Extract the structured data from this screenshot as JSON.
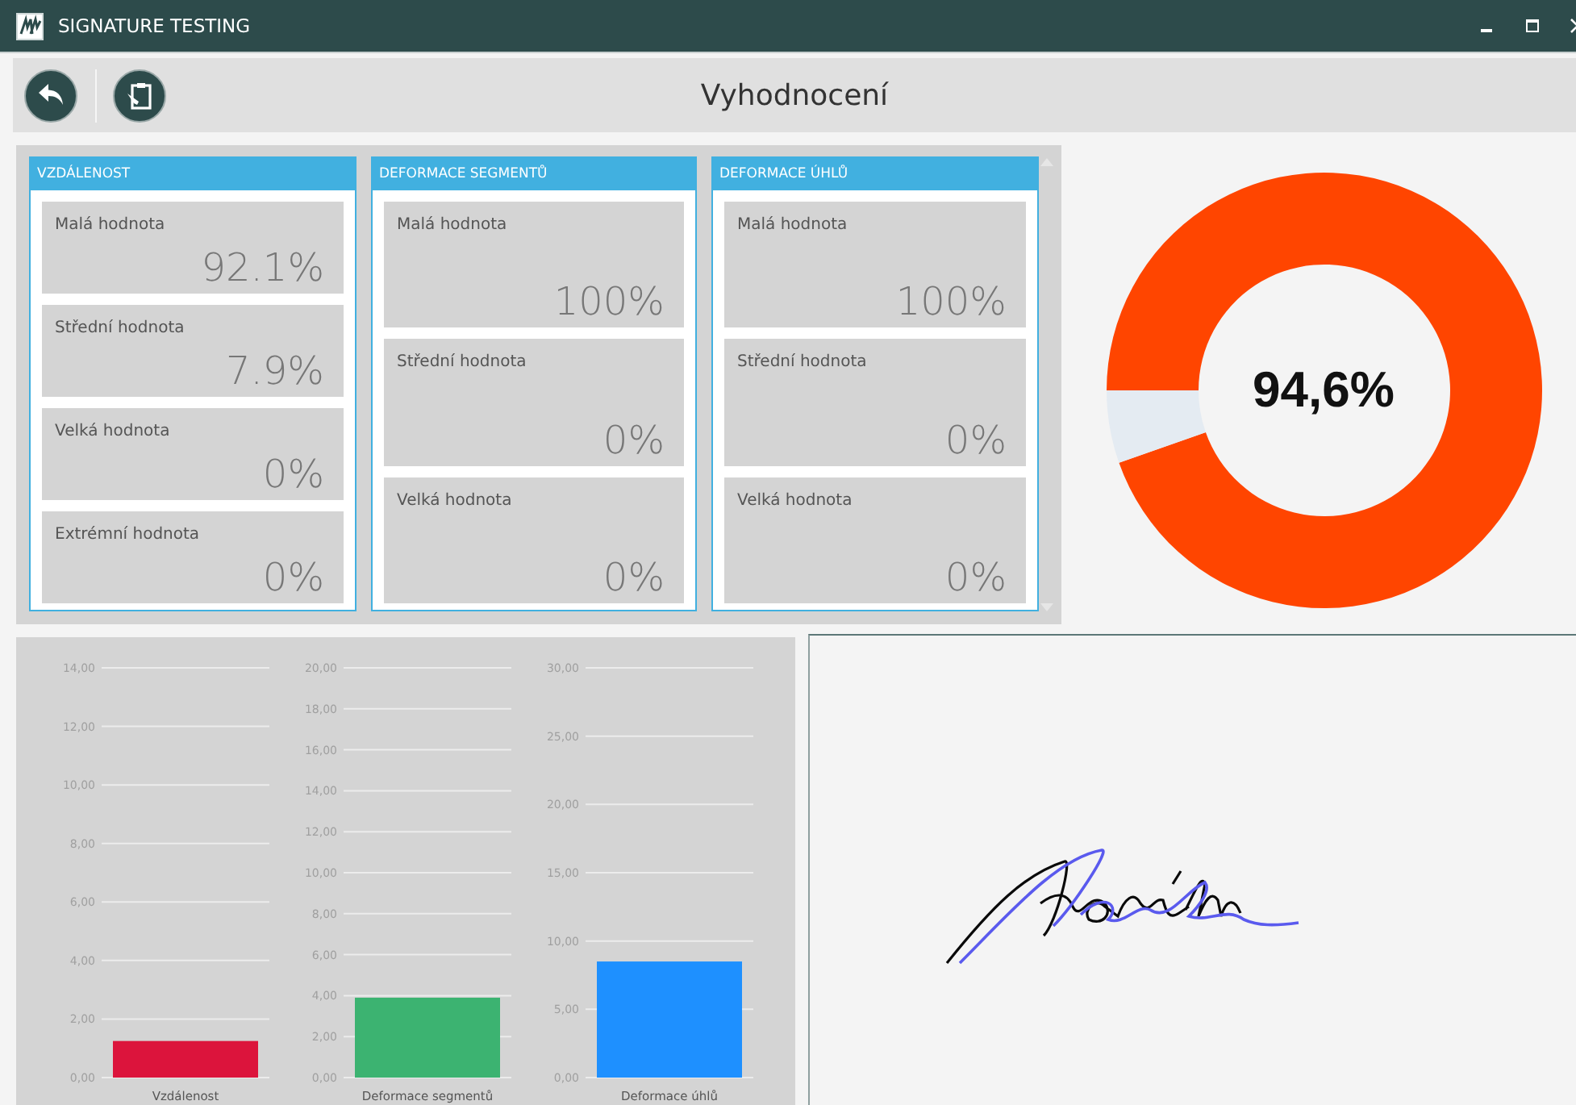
{
  "window": {
    "title": "SIGNATURE TESTING"
  },
  "toolbar": {
    "title": "Vyhodnocení"
  },
  "cards": [
    {
      "title": "VZDÁLENOST",
      "items": [
        {
          "label": "Malá hodnota",
          "value": "92.1%"
        },
        {
          "label": "Střední hodnota",
          "value": "7.9%"
        },
        {
          "label": "Velká hodnota",
          "value": "0%"
        },
        {
          "label": "Extrémní hodnota",
          "value": "0%"
        }
      ]
    },
    {
      "title": "DEFORMACE SEGMENTŮ",
      "items": [
        {
          "label": "Malá hodnota",
          "value": "100%"
        },
        {
          "label": "Střední hodnota",
          "value": "0%"
        },
        {
          "label": "Velká hodnota",
          "value": "0%"
        }
      ]
    },
    {
      "title": "DEFORMACE ÚHLŮ",
      "items": [
        {
          "label": "Malá hodnota",
          "value": "100%"
        },
        {
          "label": "Střední hodnota",
          "value": "0%"
        },
        {
          "label": "Velká hodnota",
          "value": "0%"
        }
      ]
    }
  ],
  "score": {
    "chart_data": {
      "type": "donut",
      "values": [
        94.6,
        5.4
      ]
    },
    "label": "94,6%"
  },
  "charts": [
    {
      "chart_data": {
        "type": "bar",
        "categories": [
          "Vzdálenost"
        ],
        "series": [
          {
            "color": "#dc143c",
            "values": [
              1.25
            ]
          }
        ],
        "grid": true,
        "ylim": [
          0,
          14
        ],
        "yticks": [
          {
            "value": 0,
            "label": "0,00"
          },
          {
            "value": 2,
            "label": "2,00"
          },
          {
            "value": 4,
            "label": "4,00"
          },
          {
            "value": 6,
            "label": "6,00"
          },
          {
            "value": 8,
            "label": "8,00"
          },
          {
            "value": 10,
            "label": "10,00"
          },
          {
            "value": 12,
            "label": "12,00"
          },
          {
            "value": 14,
            "label": "14,00"
          }
        ]
      }
    },
    {
      "chart_data": {
        "type": "bar",
        "categories": [
          "Deformace segmentů"
        ],
        "series": [
          {
            "color": "#3cb371",
            "values": [
              3.9
            ]
          }
        ],
        "grid": true,
        "ylim": [
          0,
          20
        ],
        "yticks": [
          {
            "value": 0,
            "label": "0,00"
          },
          {
            "value": 2,
            "label": "2,00"
          },
          {
            "value": 4,
            "label": "4,00"
          },
          {
            "value": 6,
            "label": "6,00"
          },
          {
            "value": 8,
            "label": "8,00"
          },
          {
            "value": 10,
            "label": "10,00"
          },
          {
            "value": 12,
            "label": "12,00"
          },
          {
            "value": 14,
            "label": "14,00"
          },
          {
            "value": 16,
            "label": "16,00"
          },
          {
            "value": 18,
            "label": "18,00"
          },
          {
            "value": 20,
            "label": "20,00"
          }
        ]
      }
    },
    {
      "chart_data": {
        "type": "bar",
        "categories": [
          "Deformace úhlů"
        ],
        "series": [
          {
            "color": "#1e90ff",
            "values": [
              8.5
            ]
          }
        ],
        "grid": true,
        "ylim": [
          0,
          30
        ],
        "yticks": [
          {
            "value": 0,
            "label": "0,00"
          },
          {
            "value": 5,
            "label": "5,00"
          },
          {
            "value": 10,
            "label": "10,00"
          },
          {
            "value": 15,
            "label": "15,00"
          },
          {
            "value": 20,
            "label": "20,00"
          },
          {
            "value": 25,
            "label": "25,00"
          },
          {
            "value": 30,
            "label": "30,00"
          }
        ]
      }
    }
  ]
}
